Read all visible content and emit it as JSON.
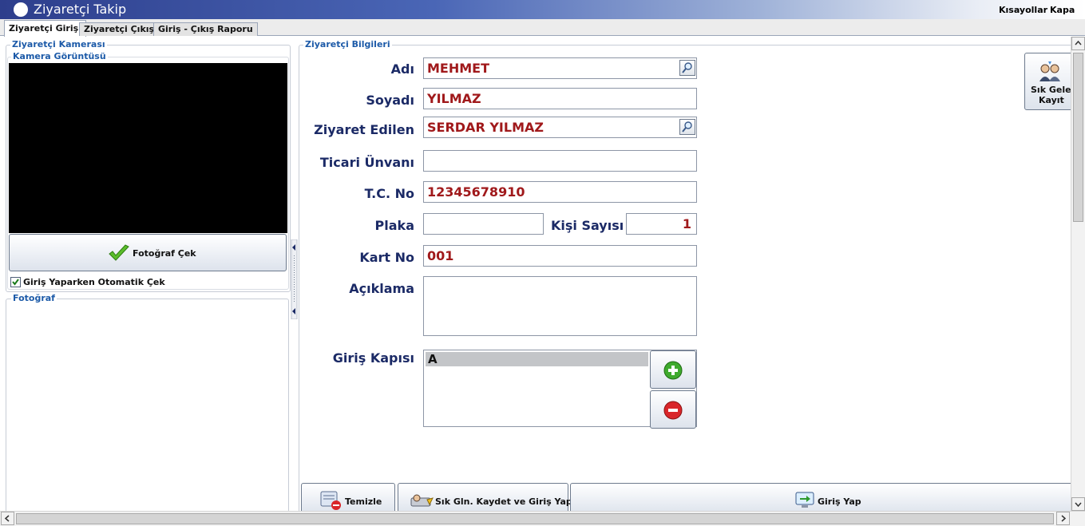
{
  "window": {
    "title": "Ziyaretçi Takip",
    "links": [
      "Kısayollar",
      "Kapa"
    ]
  },
  "tabs": [
    {
      "label": "Ziyaretçi Girişi",
      "active": true
    },
    {
      "label": "Ziyaretçi Çıkışı",
      "active": false
    },
    {
      "label": "Giriş - Çıkış Raporu",
      "active": false
    }
  ],
  "left_panel": {
    "camera_group_title": "Ziyaretçi Kamerası",
    "camera_view_title": "Kamera Görüntüsü",
    "photo_button_label": "Fotoğraf Çek",
    "auto_capture_label": "Giriş Yaparken Otomatik Çek",
    "auto_capture_checked": true,
    "photo_group_title": "Fotoğraf"
  },
  "form": {
    "group_title": "Ziyaretçi Bilgileri",
    "labels": {
      "name": "Adı",
      "surname": "Soyadı",
      "visited": "Ziyaret Edilen",
      "company": "Ticari Ünvanı",
      "tc": "T.C. No",
      "plate": "Plaka",
      "count": "Kişi Sayısı",
      "card": "Kart No",
      "desc": "Açıklama",
      "gate": "Giriş Kapısı"
    },
    "values": {
      "name": "MEHMET",
      "surname": "YILMAZ",
      "visited": "SERDAR YILMAZ",
      "company": "",
      "tc": "12345678910",
      "plate": "",
      "count": "1",
      "card": "001",
      "desc": ""
    },
    "gate_options": [
      "A"
    ],
    "gate_selected": "A",
    "frequent_button_label_1": "Sık Gelen",
    "frequent_button_label_2": "Kayıt"
  },
  "actions": {
    "clear_label": "Temizle",
    "save_frequent_label": "Sık Gln. Kaydet ve Giriş Yap",
    "enter_label": "Giriş Yap"
  },
  "colors": {
    "accent": "#1c5aa8",
    "label": "#1b2a66",
    "value": "#a0191b"
  }
}
